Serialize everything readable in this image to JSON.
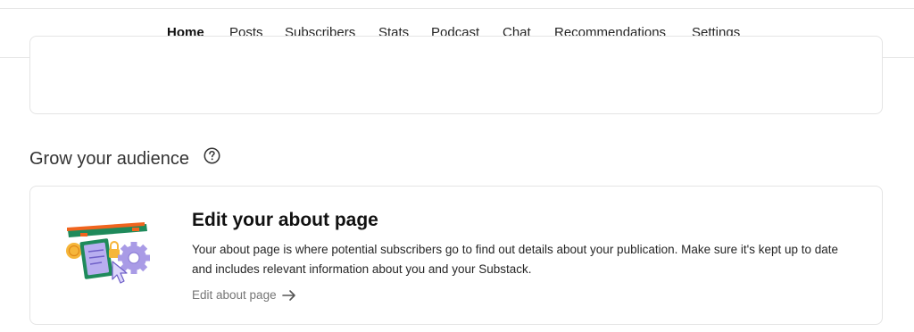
{
  "nav": {
    "items": [
      {
        "label": "Home",
        "active": true
      },
      {
        "label": "Posts",
        "active": false
      },
      {
        "label": "Subscribers",
        "active": false
      },
      {
        "label": "Stats",
        "active": false
      },
      {
        "label": "Podcast",
        "active": false
      },
      {
        "label": "Chat",
        "active": false
      },
      {
        "label": "Recommendations",
        "active": false
      },
      {
        "label": "Settings",
        "active": false
      }
    ]
  },
  "grow": {
    "title": "Grow your audience",
    "help_icon": "question-circle-icon"
  },
  "about_card": {
    "title": "Edit your about page",
    "description": "Your about page is where potential subscribers go to find out details about your publication. Make sure it's kept up to date and includes relevant information about you and your Substack.",
    "link_label": "Edit about page",
    "link_icon": "arrow-right-icon",
    "illustration": "clipboard-gear-illustration"
  },
  "colors": {
    "accent_orange": "#f0641e",
    "illus_green": "#1f8a5b",
    "illus_purple": "#a99be6"
  }
}
